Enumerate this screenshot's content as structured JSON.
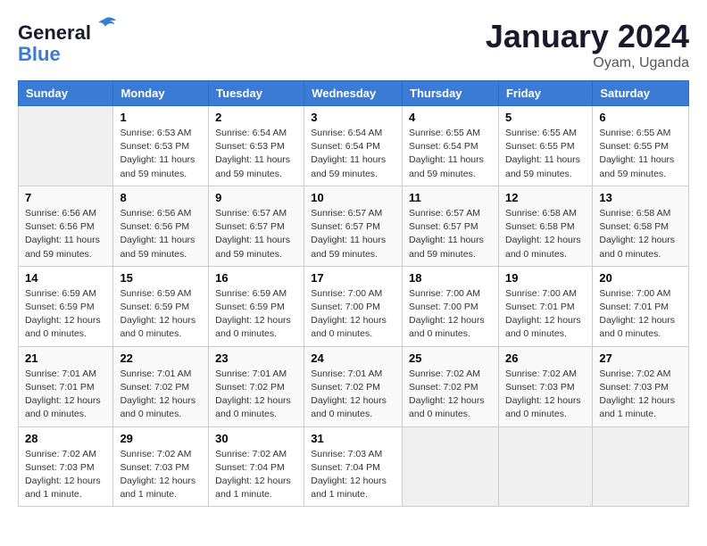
{
  "logo": {
    "line1": "General",
    "line2": "Blue"
  },
  "title": "January 2024",
  "location": "Oyam, Uganda",
  "days_of_week": [
    "Sunday",
    "Monday",
    "Tuesday",
    "Wednesday",
    "Thursday",
    "Friday",
    "Saturday"
  ],
  "weeks": [
    [
      {
        "day": "",
        "info": ""
      },
      {
        "day": "1",
        "info": "Sunrise: 6:53 AM\nSunset: 6:53 PM\nDaylight: 11 hours and 59 minutes."
      },
      {
        "day": "2",
        "info": "Sunrise: 6:54 AM\nSunset: 6:53 PM\nDaylight: 11 hours and 59 minutes."
      },
      {
        "day": "3",
        "info": "Sunrise: 6:54 AM\nSunset: 6:54 PM\nDaylight: 11 hours and 59 minutes."
      },
      {
        "day": "4",
        "info": "Sunrise: 6:55 AM\nSunset: 6:54 PM\nDaylight: 11 hours and 59 minutes."
      },
      {
        "day": "5",
        "info": "Sunrise: 6:55 AM\nSunset: 6:55 PM\nDaylight: 11 hours and 59 minutes."
      },
      {
        "day": "6",
        "info": "Sunrise: 6:55 AM\nSunset: 6:55 PM\nDaylight: 11 hours and 59 minutes."
      }
    ],
    [
      {
        "day": "7",
        "info": "Sunrise: 6:56 AM\nSunset: 6:56 PM\nDaylight: 11 hours and 59 minutes."
      },
      {
        "day": "8",
        "info": "Sunrise: 6:56 AM\nSunset: 6:56 PM\nDaylight: 11 hours and 59 minutes."
      },
      {
        "day": "9",
        "info": "Sunrise: 6:57 AM\nSunset: 6:57 PM\nDaylight: 11 hours and 59 minutes."
      },
      {
        "day": "10",
        "info": "Sunrise: 6:57 AM\nSunset: 6:57 PM\nDaylight: 11 hours and 59 minutes."
      },
      {
        "day": "11",
        "info": "Sunrise: 6:57 AM\nSunset: 6:57 PM\nDaylight: 11 hours and 59 minutes."
      },
      {
        "day": "12",
        "info": "Sunrise: 6:58 AM\nSunset: 6:58 PM\nDaylight: 12 hours and 0 minutes."
      },
      {
        "day": "13",
        "info": "Sunrise: 6:58 AM\nSunset: 6:58 PM\nDaylight: 12 hours and 0 minutes."
      }
    ],
    [
      {
        "day": "14",
        "info": "Sunrise: 6:59 AM\nSunset: 6:59 PM\nDaylight: 12 hours and 0 minutes."
      },
      {
        "day": "15",
        "info": "Sunrise: 6:59 AM\nSunset: 6:59 PM\nDaylight: 12 hours and 0 minutes."
      },
      {
        "day": "16",
        "info": "Sunrise: 6:59 AM\nSunset: 6:59 PM\nDaylight: 12 hours and 0 minutes."
      },
      {
        "day": "17",
        "info": "Sunrise: 7:00 AM\nSunset: 7:00 PM\nDaylight: 12 hours and 0 minutes."
      },
      {
        "day": "18",
        "info": "Sunrise: 7:00 AM\nSunset: 7:00 PM\nDaylight: 12 hours and 0 minutes."
      },
      {
        "day": "19",
        "info": "Sunrise: 7:00 AM\nSunset: 7:01 PM\nDaylight: 12 hours and 0 minutes."
      },
      {
        "day": "20",
        "info": "Sunrise: 7:00 AM\nSunset: 7:01 PM\nDaylight: 12 hours and 0 minutes."
      }
    ],
    [
      {
        "day": "21",
        "info": "Sunrise: 7:01 AM\nSunset: 7:01 PM\nDaylight: 12 hours and 0 minutes."
      },
      {
        "day": "22",
        "info": "Sunrise: 7:01 AM\nSunset: 7:02 PM\nDaylight: 12 hours and 0 minutes."
      },
      {
        "day": "23",
        "info": "Sunrise: 7:01 AM\nSunset: 7:02 PM\nDaylight: 12 hours and 0 minutes."
      },
      {
        "day": "24",
        "info": "Sunrise: 7:01 AM\nSunset: 7:02 PM\nDaylight: 12 hours and 0 minutes."
      },
      {
        "day": "25",
        "info": "Sunrise: 7:02 AM\nSunset: 7:02 PM\nDaylight: 12 hours and 0 minutes."
      },
      {
        "day": "26",
        "info": "Sunrise: 7:02 AM\nSunset: 7:03 PM\nDaylight: 12 hours and 0 minutes."
      },
      {
        "day": "27",
        "info": "Sunrise: 7:02 AM\nSunset: 7:03 PM\nDaylight: 12 hours and 1 minute."
      }
    ],
    [
      {
        "day": "28",
        "info": "Sunrise: 7:02 AM\nSunset: 7:03 PM\nDaylight: 12 hours and 1 minute."
      },
      {
        "day": "29",
        "info": "Sunrise: 7:02 AM\nSunset: 7:03 PM\nDaylight: 12 hours and 1 minute."
      },
      {
        "day": "30",
        "info": "Sunrise: 7:02 AM\nSunset: 7:04 PM\nDaylight: 12 hours and 1 minute."
      },
      {
        "day": "31",
        "info": "Sunrise: 7:03 AM\nSunset: 7:04 PM\nDaylight: 12 hours and 1 minute."
      },
      {
        "day": "",
        "info": ""
      },
      {
        "day": "",
        "info": ""
      },
      {
        "day": "",
        "info": ""
      }
    ]
  ]
}
